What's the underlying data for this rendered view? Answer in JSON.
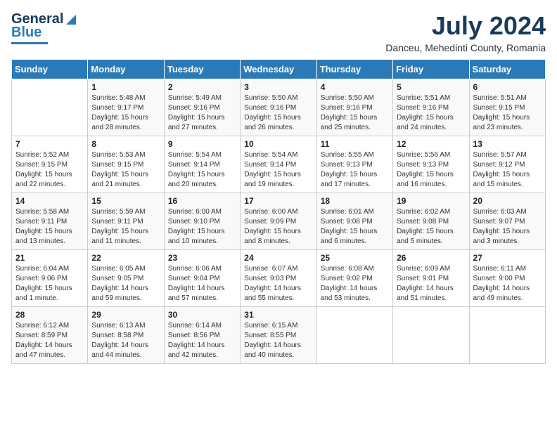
{
  "header": {
    "logo_line1": "General",
    "logo_line2": "Blue",
    "title": "July 2024",
    "subtitle": "Danceu, Mehedinti County, Romania"
  },
  "days_of_week": [
    "Sunday",
    "Monday",
    "Tuesday",
    "Wednesday",
    "Thursday",
    "Friday",
    "Saturday"
  ],
  "weeks": [
    [
      {
        "day": "",
        "info": ""
      },
      {
        "day": "1",
        "info": "Sunrise: 5:48 AM\nSunset: 9:17 PM\nDaylight: 15 hours\nand 28 minutes."
      },
      {
        "day": "2",
        "info": "Sunrise: 5:49 AM\nSunset: 9:16 PM\nDaylight: 15 hours\nand 27 minutes."
      },
      {
        "day": "3",
        "info": "Sunrise: 5:50 AM\nSunset: 9:16 PM\nDaylight: 15 hours\nand 26 minutes."
      },
      {
        "day": "4",
        "info": "Sunrise: 5:50 AM\nSunset: 9:16 PM\nDaylight: 15 hours\nand 25 minutes."
      },
      {
        "day": "5",
        "info": "Sunrise: 5:51 AM\nSunset: 9:16 PM\nDaylight: 15 hours\nand 24 minutes."
      },
      {
        "day": "6",
        "info": "Sunrise: 5:51 AM\nSunset: 9:15 PM\nDaylight: 15 hours\nand 23 minutes."
      }
    ],
    [
      {
        "day": "7",
        "info": "Sunrise: 5:52 AM\nSunset: 9:15 PM\nDaylight: 15 hours\nand 22 minutes."
      },
      {
        "day": "8",
        "info": "Sunrise: 5:53 AM\nSunset: 9:15 PM\nDaylight: 15 hours\nand 21 minutes."
      },
      {
        "day": "9",
        "info": "Sunrise: 5:54 AM\nSunset: 9:14 PM\nDaylight: 15 hours\nand 20 minutes."
      },
      {
        "day": "10",
        "info": "Sunrise: 5:54 AM\nSunset: 9:14 PM\nDaylight: 15 hours\nand 19 minutes."
      },
      {
        "day": "11",
        "info": "Sunrise: 5:55 AM\nSunset: 9:13 PM\nDaylight: 15 hours\nand 17 minutes."
      },
      {
        "day": "12",
        "info": "Sunrise: 5:56 AM\nSunset: 9:13 PM\nDaylight: 15 hours\nand 16 minutes."
      },
      {
        "day": "13",
        "info": "Sunrise: 5:57 AM\nSunset: 9:12 PM\nDaylight: 15 hours\nand 15 minutes."
      }
    ],
    [
      {
        "day": "14",
        "info": "Sunrise: 5:58 AM\nSunset: 9:11 PM\nDaylight: 15 hours\nand 13 minutes."
      },
      {
        "day": "15",
        "info": "Sunrise: 5:59 AM\nSunset: 9:11 PM\nDaylight: 15 hours\nand 11 minutes."
      },
      {
        "day": "16",
        "info": "Sunrise: 6:00 AM\nSunset: 9:10 PM\nDaylight: 15 hours\nand 10 minutes."
      },
      {
        "day": "17",
        "info": "Sunrise: 6:00 AM\nSunset: 9:09 PM\nDaylight: 15 hours\nand 8 minutes."
      },
      {
        "day": "18",
        "info": "Sunrise: 6:01 AM\nSunset: 9:08 PM\nDaylight: 15 hours\nand 6 minutes."
      },
      {
        "day": "19",
        "info": "Sunrise: 6:02 AM\nSunset: 9:08 PM\nDaylight: 15 hours\nand 5 minutes."
      },
      {
        "day": "20",
        "info": "Sunrise: 6:03 AM\nSunset: 9:07 PM\nDaylight: 15 hours\nand 3 minutes."
      }
    ],
    [
      {
        "day": "21",
        "info": "Sunrise: 6:04 AM\nSunset: 9:06 PM\nDaylight: 15 hours\nand 1 minute."
      },
      {
        "day": "22",
        "info": "Sunrise: 6:05 AM\nSunset: 9:05 PM\nDaylight: 14 hours\nand 59 minutes."
      },
      {
        "day": "23",
        "info": "Sunrise: 6:06 AM\nSunset: 9:04 PM\nDaylight: 14 hours\nand 57 minutes."
      },
      {
        "day": "24",
        "info": "Sunrise: 6:07 AM\nSunset: 9:03 PM\nDaylight: 14 hours\nand 55 minutes."
      },
      {
        "day": "25",
        "info": "Sunrise: 6:08 AM\nSunset: 9:02 PM\nDaylight: 14 hours\nand 53 minutes."
      },
      {
        "day": "26",
        "info": "Sunrise: 6:09 AM\nSunset: 9:01 PM\nDaylight: 14 hours\nand 51 minutes."
      },
      {
        "day": "27",
        "info": "Sunrise: 6:11 AM\nSunset: 9:00 PM\nDaylight: 14 hours\nand 49 minutes."
      }
    ],
    [
      {
        "day": "28",
        "info": "Sunrise: 6:12 AM\nSunset: 8:59 PM\nDaylight: 14 hours\nand 47 minutes."
      },
      {
        "day": "29",
        "info": "Sunrise: 6:13 AM\nSunset: 8:58 PM\nDaylight: 14 hours\nand 44 minutes."
      },
      {
        "day": "30",
        "info": "Sunrise: 6:14 AM\nSunset: 8:56 PM\nDaylight: 14 hours\nand 42 minutes."
      },
      {
        "day": "31",
        "info": "Sunrise: 6:15 AM\nSunset: 8:55 PM\nDaylight: 14 hours\nand 40 minutes."
      },
      {
        "day": "",
        "info": ""
      },
      {
        "day": "",
        "info": ""
      },
      {
        "day": "",
        "info": ""
      }
    ]
  ]
}
